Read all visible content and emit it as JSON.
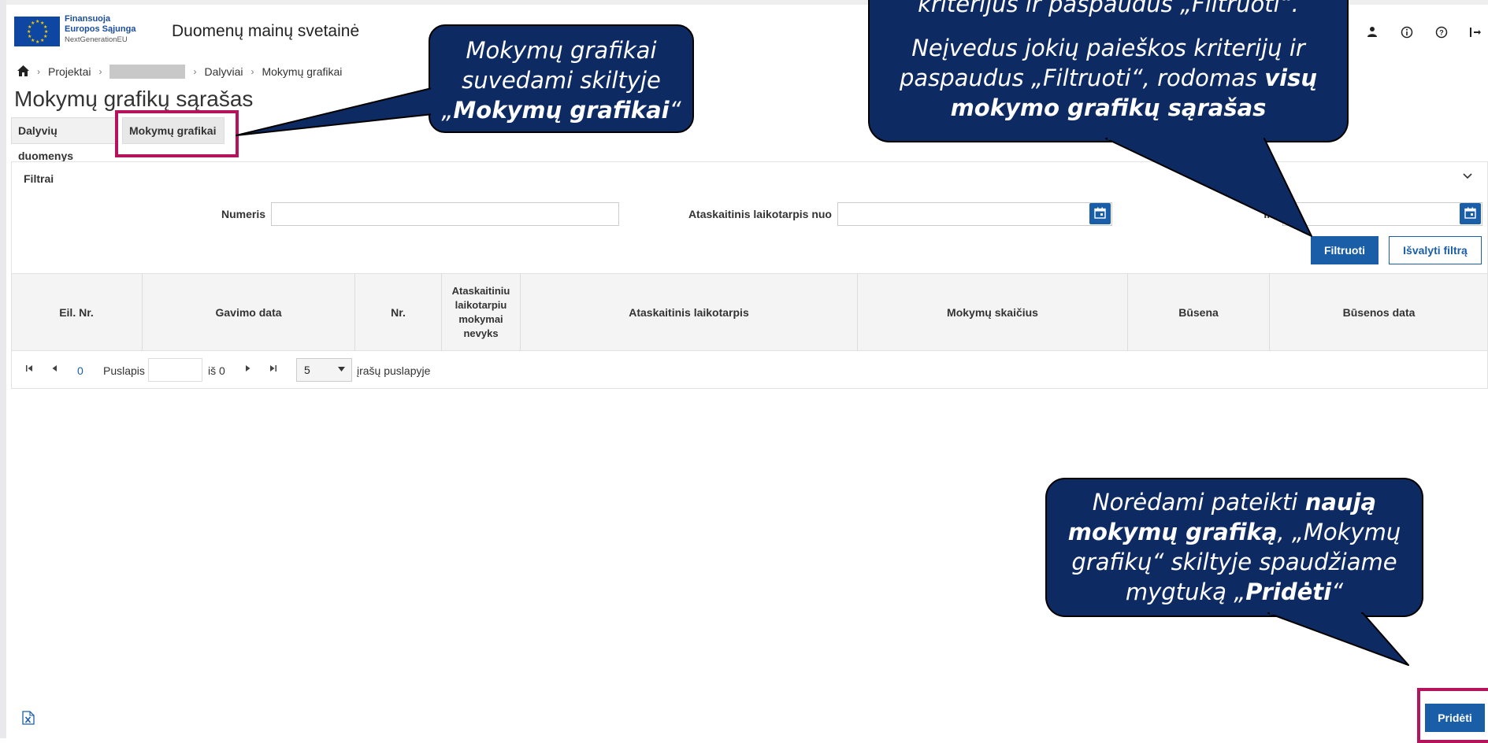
{
  "header": {
    "eu_line1": "Finansuoja",
    "eu_line2": "Europos Sąjunga",
    "eu_line3": "NextGenerationEU",
    "app_title": "Duomenų mainų svetainė",
    "icons": [
      "user-icon",
      "info-icon",
      "help-icon",
      "logout-icon"
    ]
  },
  "breadcrumb": {
    "home_icon": "home-icon",
    "items": [
      "Projektai",
      "Dalyviai",
      "Mokymų grafikai"
    ]
  },
  "page_title": "Mokymų grafikų sąrašas",
  "tabs": [
    "Dalyvių duomenys",
    "Mokymų grafikai"
  ],
  "filters": {
    "title": "Filtrai",
    "numeris_label": "Numeris",
    "nuo_label": "Ataskaitinis laikotarpis nuo",
    "iki_label": "Iki",
    "filter_button": "Filtruoti",
    "clear_button": "Išvalyti filtrą"
  },
  "table": {
    "columns": [
      "Eil. Nr.",
      "Gavimo data",
      "Nr.",
      "Ataskaitiniu laikotarpiu mokymai nevyks",
      "Ataskaitinis laikotarpis",
      "Mokymų skaičius",
      "Būsena",
      "Būsenos data"
    ]
  },
  "pagination": {
    "current": "0",
    "page_label": "Puslapis",
    "of_label": "iš 0",
    "page_size": "5",
    "per_page_label": "įrašų puslapyje"
  },
  "add_button": "Pridėti",
  "callouts": {
    "tabs": {
      "l1": "Mokymų grafikai",
      "l2": "suvedami skiltyje",
      "l3_pre": "„",
      "l3_bold": "Mokymų grafikai",
      "l3_post": "“"
    },
    "filter": {
      "l0": "kriterijus ir paspaudus „Filtruoti“.",
      "l1": "Neįvedus jokių paieškos kriterijų ir",
      "l2_pre": "paspaudus „Filtruoti“, rodomas ",
      "l2_bold": "visų",
      "l3_bold": "mokymo grafikų sąrašas"
    },
    "add": {
      "l1_pre": "Norėdami pateikti ",
      "l1_bold": "naują",
      "l2_bold": "mokymų grafiką",
      "l2_post": ", „Mokymų",
      "l3": "grafikų“ skiltyje spaudžiame",
      "l4_pre": "mygtuką „",
      "l4_bold": "Pridėti",
      "l4_post": "“"
    }
  },
  "colors": {
    "primary": "#1a5ea8",
    "callout_fill": "#0e2a63",
    "highlight": "#b5135c"
  }
}
